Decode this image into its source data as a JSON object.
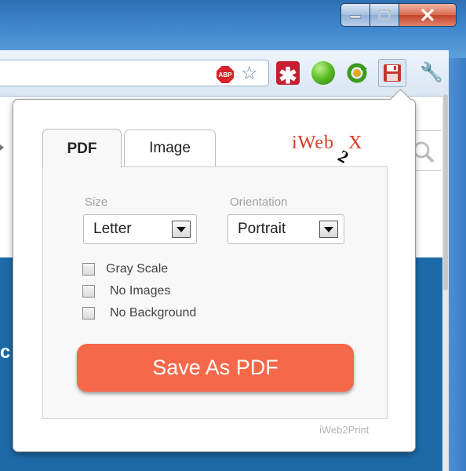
{
  "window": {
    "minimize_glyph": "minimize",
    "maximize_glyph": "maximize",
    "close_glyph": "close"
  },
  "toolbar": {
    "adblock_label": "ABP",
    "icons": [
      "adblock-icon",
      "bookmark-star-icon",
      "asterisk-extension-icon",
      "green-orb-extension-icon",
      "refresh-extension-icon",
      "save-floppy-icon",
      "wrench-icon"
    ]
  },
  "page": {
    "partial_letter": "c"
  },
  "popup": {
    "tabs": [
      {
        "label": "PDF",
        "active": true
      },
      {
        "label": "Image",
        "active": false
      }
    ],
    "logo": {
      "prefix": "iWeb",
      "two": "2",
      "suffix": "X"
    },
    "size": {
      "label": "Size",
      "value": "Letter"
    },
    "orientation": {
      "label": "Orientation",
      "value": "Portrait"
    },
    "options": [
      {
        "label": "Gray Scale",
        "checked": false
      },
      {
        "label": "No Images",
        "checked": false
      },
      {
        "label": "No Background",
        "checked": false
      }
    ],
    "save_button": "Save As PDF",
    "footer": "iWeb2Print"
  },
  "colors": {
    "accent_button": "#f5694a",
    "logo_red": "#d83a24",
    "frame_blue": "#3d86cc"
  }
}
